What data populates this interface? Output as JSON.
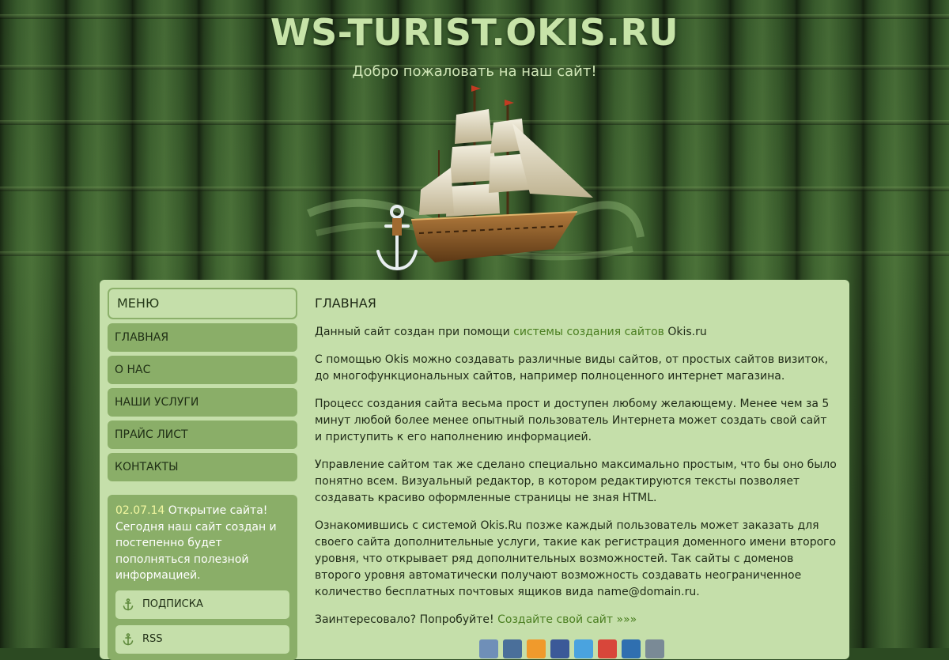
{
  "header": {
    "title": "WS-TURIST.OKIS.RU",
    "subtitle": "Добро пожаловать на наш сайт!"
  },
  "sidebar": {
    "menu_title": "МЕНЮ",
    "items": [
      {
        "label": "ГЛАВНАЯ"
      },
      {
        "label": "О НАС"
      },
      {
        "label": "НАШИ УСЛУГИ"
      },
      {
        "label": "ПРАЙС ЛИСТ"
      },
      {
        "label": "КОНТАКТЫ"
      }
    ],
    "news": {
      "date": "02.07.14",
      "text": " Открытие сайта! Сегодня наш сайт создан и постепенно будет пополняться полезной информацией."
    },
    "buttons": [
      {
        "label": "ПОДПИСКА",
        "icon": "anchor-icon"
      },
      {
        "label": "RSS",
        "icon": "anchor-icon"
      }
    ]
  },
  "main": {
    "heading": "ГЛАВНАЯ",
    "p1_before": "Данный сайт создан при помощи ",
    "p1_link": "системы создания сайтов",
    "p1_after": " Okis.ru",
    "p2": "С помощью Okis можно создавать различные виды сайтов, от простых сайтов визиток, до многофункциональных сайтов, например полноценного интернет магазина.",
    "p3": "Процесс создания сайта весьма прост и доступен любому желающему. Менее чем за 5 минут любой более менее опытный пользователь Интернета может создать свой сайт и приступить к его наполнению информацией.",
    "p4": "Управление сайтом так же сделано специально максимально простым, что бы оно было понятно всем. Визуальный редактор, в котором редактируются тексты позволяет создавать красиво оформленные страницы не зная HTML.",
    "p5": "Ознакомившись с системой Okis.Ru позже каждый пользователь может заказать для своего сайта дополнительные услуги, такие как регистрация доменного имени второго уровня, что открывает ряд дополнительных возможностей. Так сайты с доменов второго уровня автоматически получают возможность создавать неограниченное количество бесплатных почтовых ящиков вида name@domain.ru.",
    "p6_before": "Заинтересовало? Попробуйте! ",
    "p6_link": "Создайте свой сайт »»»"
  },
  "share_icons": [
    {
      "name": "livejournal-icon",
      "color": "#6f8fb8"
    },
    {
      "name": "vkontakte-icon",
      "color": "#4a6f9a"
    },
    {
      "name": "odnoklassniki-icon",
      "color": "#f09a2c"
    },
    {
      "name": "facebook-icon",
      "color": "#3b5998"
    },
    {
      "name": "twitter-icon",
      "color": "#4aa3df"
    },
    {
      "name": "googleplus-icon",
      "color": "#d8463a"
    },
    {
      "name": "mailru-icon",
      "color": "#2f6fb0"
    },
    {
      "name": "bookmark-icon",
      "color": "#7a8a96"
    }
  ],
  "colors": {
    "title": "#c7e3a8",
    "panel": "#c5dfaa",
    "nav": "#8aae68",
    "link": "#4a7e20",
    "news_date": "#f2f7a0"
  }
}
